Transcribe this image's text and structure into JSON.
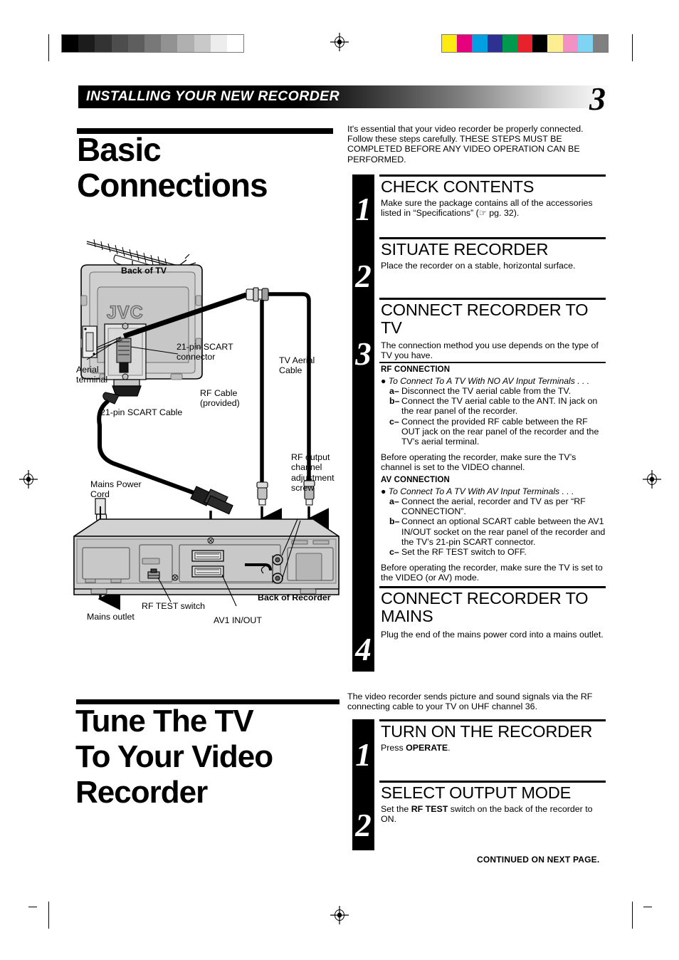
{
  "header": {
    "band_title": "INSTALLING YOUR NEW RECORDER",
    "page_number": "3"
  },
  "section1": {
    "title": "Basic\nConnections",
    "intro": "It's essential that your video recorder be properly connected. Follow these steps carefully. THESE STEPS MUST BE COMPLETED BEFORE ANY VIDEO OPERATION CAN BE PERFORMED.",
    "steps": [
      {
        "number": "1",
        "heading": "CHECK CONTENTS",
        "body": "Make sure the package contains all of the accessories listed in “Specifications” (☞ pg. 32)."
      },
      {
        "number": "2",
        "heading": "SITUATE RECORDER",
        "body": "Place the recorder on a stable, horizontal surface."
      },
      {
        "number": "3",
        "heading": "CONNECT RECORDER TO TV",
        "body": "The connection method you use depends on the type of TV you have.",
        "groups": [
          {
            "subhead": "RF CONNECTION",
            "bullet": "To Connect To A TV With NO AV Input Terminals . . .",
            "substeps": [
              {
                "label": "a–",
                "text": "Disconnect the TV aerial cable from the TV."
              },
              {
                "label": "b–",
                "text": "Connect the TV aerial cable to the ANT. IN jack on the rear panel of the recorder."
              },
              {
                "label": "c–",
                "text": "Connect the provided RF cable between the RF OUT jack on the rear panel of the recorder and the TV’s aerial terminal."
              }
            ],
            "note": "Before operating the recorder, make sure the TV’s channel is set to the VIDEO channel."
          },
          {
            "subhead": "AV CONNECTION",
            "bullet": "To Connect To A TV With AV Input Terminals . . .",
            "substeps": [
              {
                "label": "a–",
                "text": "Connect the aerial, recorder and TV as per “RF CONNECTION”."
              },
              {
                "label": "b–",
                "text": "Connect an optional SCART cable between the AV1 IN/OUT socket on the rear panel of the recorder and the TV’s 21-pin SCART connector."
              },
              {
                "label": "c–",
                "text": "Set the RF TEST switch to OFF."
              }
            ],
            "note": "Before operating the recorder, make sure the TV is set to the VIDEO (or AV) mode."
          }
        ]
      },
      {
        "number": "4",
        "heading": "CONNECT RECORDER TO MAINS",
        "body": "Plug the end of the mains power cord into a mains outlet."
      }
    ]
  },
  "section2": {
    "title": "Tune The TV\nTo Your Video\nRecorder",
    "intro": "The video recorder sends picture and sound signals via the RF connecting cable to your TV on UHF channel 36.",
    "steps": [
      {
        "number": "1",
        "heading": "TURN ON THE RECORDER",
        "body_prefix": "Press ",
        "body_bold": "OPERATE",
        "body_suffix": "."
      },
      {
        "number": "2",
        "heading": "SELECT OUTPUT MODE",
        "body_prefix": "Set the ",
        "body_bold": "RF TEST",
        "body_suffix": " switch on the back of the recorder to ON."
      }
    ],
    "continued": "CONTINUED ON NEXT PAGE."
  },
  "diagram": {
    "labels": {
      "back_of_tv": "Back of TV",
      "brand": "JVC",
      "aerial_terminal": "Aerial\nterminal",
      "scart_connector": "21-pin SCART\nconnector",
      "scart_cable": "21-pin SCART Cable",
      "rf_cable": "RF Cable\n(provided)",
      "tv_aerial_cable": "TV Aerial\nCable",
      "rf_output_screw": "RF output\nchannel\nadjustment\nscrew",
      "mains_power_cord": "Mains Power\nCord",
      "mains_outlet": "Mains outlet",
      "rf_test_switch": "RF TEST switch",
      "av1_in_out": "AV1 IN/OUT",
      "back_of_recorder": "Back of Recorder"
    }
  },
  "printer_marks": {
    "grayscale_steps": [
      "#000000",
      "#1c1c1c",
      "#333333",
      "#4d4d4d",
      "#5e5e5e",
      "#787878",
      "#929292",
      "#b0b0b0",
      "#c9c9c9",
      "#ededed",
      "#ffffff"
    ],
    "color_swatches": [
      "#fcea10",
      "#e5007e",
      "#00a0e3",
      "#2e3192",
      "#009a4e",
      "#e8212a",
      "#000000",
      "#fdee92",
      "#f391c4",
      "#7fd4f4",
      "#808080"
    ]
  }
}
